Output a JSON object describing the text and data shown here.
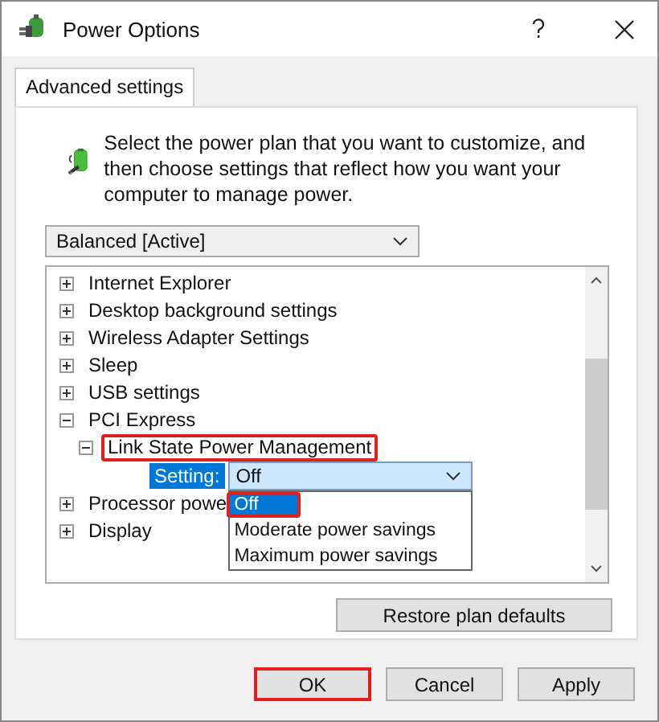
{
  "window": {
    "title": "Power Options"
  },
  "tabs": [
    {
      "label": "Advanced settings",
      "selected": true
    }
  ],
  "description": "Select the power plan that you want to customize, and then choose settings that reflect how you want your computer to manage power.",
  "plan_select": {
    "value": "Balanced [Active]"
  },
  "tree": [
    {
      "label": "Internet Explorer",
      "expanded": false
    },
    {
      "label": "Desktop background settings",
      "expanded": false
    },
    {
      "label": "Wireless Adapter Settings",
      "expanded": false
    },
    {
      "label": "Sleep",
      "expanded": false
    },
    {
      "label": "USB settings",
      "expanded": false
    },
    {
      "label": "PCI Express",
      "expanded": true,
      "children": [
        {
          "label": "Link State Power Management",
          "expanded": true,
          "highlighted": true,
          "setting": {
            "label": "Setting:",
            "value": "Off",
            "open": true,
            "options": [
              {
                "label": "Off",
                "selected": true,
                "highlighted": true
              },
              {
                "label": "Moderate power savings",
                "selected": false,
                "highlighted": false
              },
              {
                "label": "Maximum power savings",
                "selected": false,
                "highlighted": false
              }
            ]
          }
        }
      ]
    },
    {
      "label": "Processor powe",
      "expanded": false
    },
    {
      "label": "Display",
      "expanded": false
    }
  ],
  "restore_button": "Restore plan defaults",
  "buttons": [
    {
      "label": "OK",
      "highlighted": true
    },
    {
      "label": "Cancel",
      "highlighted": false
    },
    {
      "label": "Apply",
      "highlighted": false
    }
  ]
}
